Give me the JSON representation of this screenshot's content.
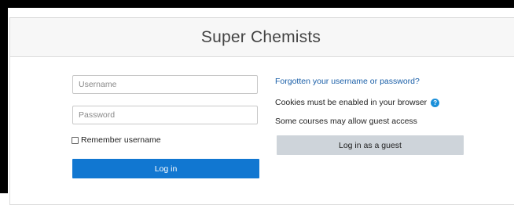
{
  "site": {
    "title": "Super Chemists"
  },
  "login": {
    "username_placeholder": "Username",
    "username_value": "",
    "password_placeholder": "Password",
    "password_value": "",
    "remember_label": "Remember username",
    "remember_checked": false,
    "login_button": "Log in"
  },
  "side": {
    "forgot_link": "Forgotten your username or password?",
    "cookies_text": "Cookies must be enabled in your browser",
    "help_icon": "?",
    "guest_text": "Some courses may allow guest access",
    "guest_button": "Log in as a guest"
  },
  "colors": {
    "primary": "#1177d1",
    "link": "#1a5fa8",
    "secondary_button": "#ced4da",
    "help_icon": "#1a8fd9"
  }
}
